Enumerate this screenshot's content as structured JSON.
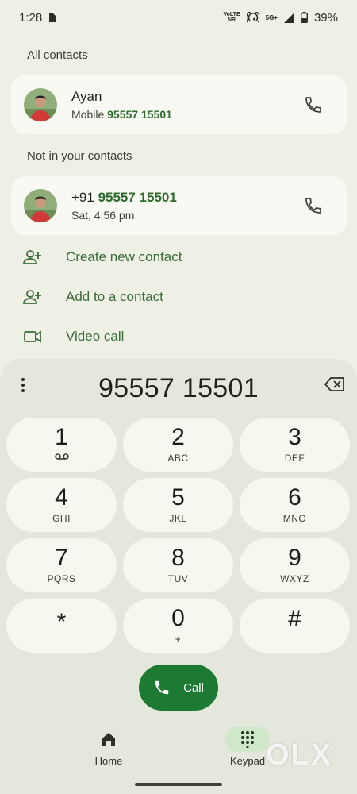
{
  "status_bar": {
    "time": "1:28",
    "volte": "Vo​l",
    "nr": "NR",
    "network": "5G+",
    "battery": "39%"
  },
  "sections": {
    "all_contacts": "All contacts",
    "not_in_contacts": "Not in your contacts"
  },
  "contact": {
    "name": "Ayan",
    "sub_prefix": "Mobile ",
    "number": "95557 15501"
  },
  "unknown": {
    "prefix": "+91 ",
    "number": "95557 15501",
    "timestamp": "Sat, 4:56 pm"
  },
  "actions": [
    {
      "label": "Create new contact",
      "icon": "add-person-icon"
    },
    {
      "label": "Add to a contact",
      "icon": "add-person-icon"
    },
    {
      "label": "Video call",
      "icon": "video-camera-icon"
    }
  ],
  "dialpad": {
    "number": "95557 15501",
    "keys": [
      {
        "digit": "1",
        "letters": ""
      },
      {
        "digit": "2",
        "letters": "ABC"
      },
      {
        "digit": "3",
        "letters": "DEF"
      },
      {
        "digit": "4",
        "letters": "GHI"
      },
      {
        "digit": "5",
        "letters": "JKL"
      },
      {
        "digit": "6",
        "letters": "MNO"
      },
      {
        "digit": "7",
        "letters": "PQRS"
      },
      {
        "digit": "8",
        "letters": "TUV"
      },
      {
        "digit": "9",
        "letters": "WXYZ"
      },
      {
        "digit": "*",
        "letters": ""
      },
      {
        "digit": "0",
        "letters": "+"
      },
      {
        "digit": "#",
        "letters": ""
      }
    ],
    "call_label": "Call"
  },
  "nav": {
    "home": "Home",
    "keypad": "Keypad"
  },
  "watermark": "OLX",
  "colors": {
    "accent": "#1d7a33",
    "link_green": "#3b6b37",
    "background": "#eef0e6"
  }
}
